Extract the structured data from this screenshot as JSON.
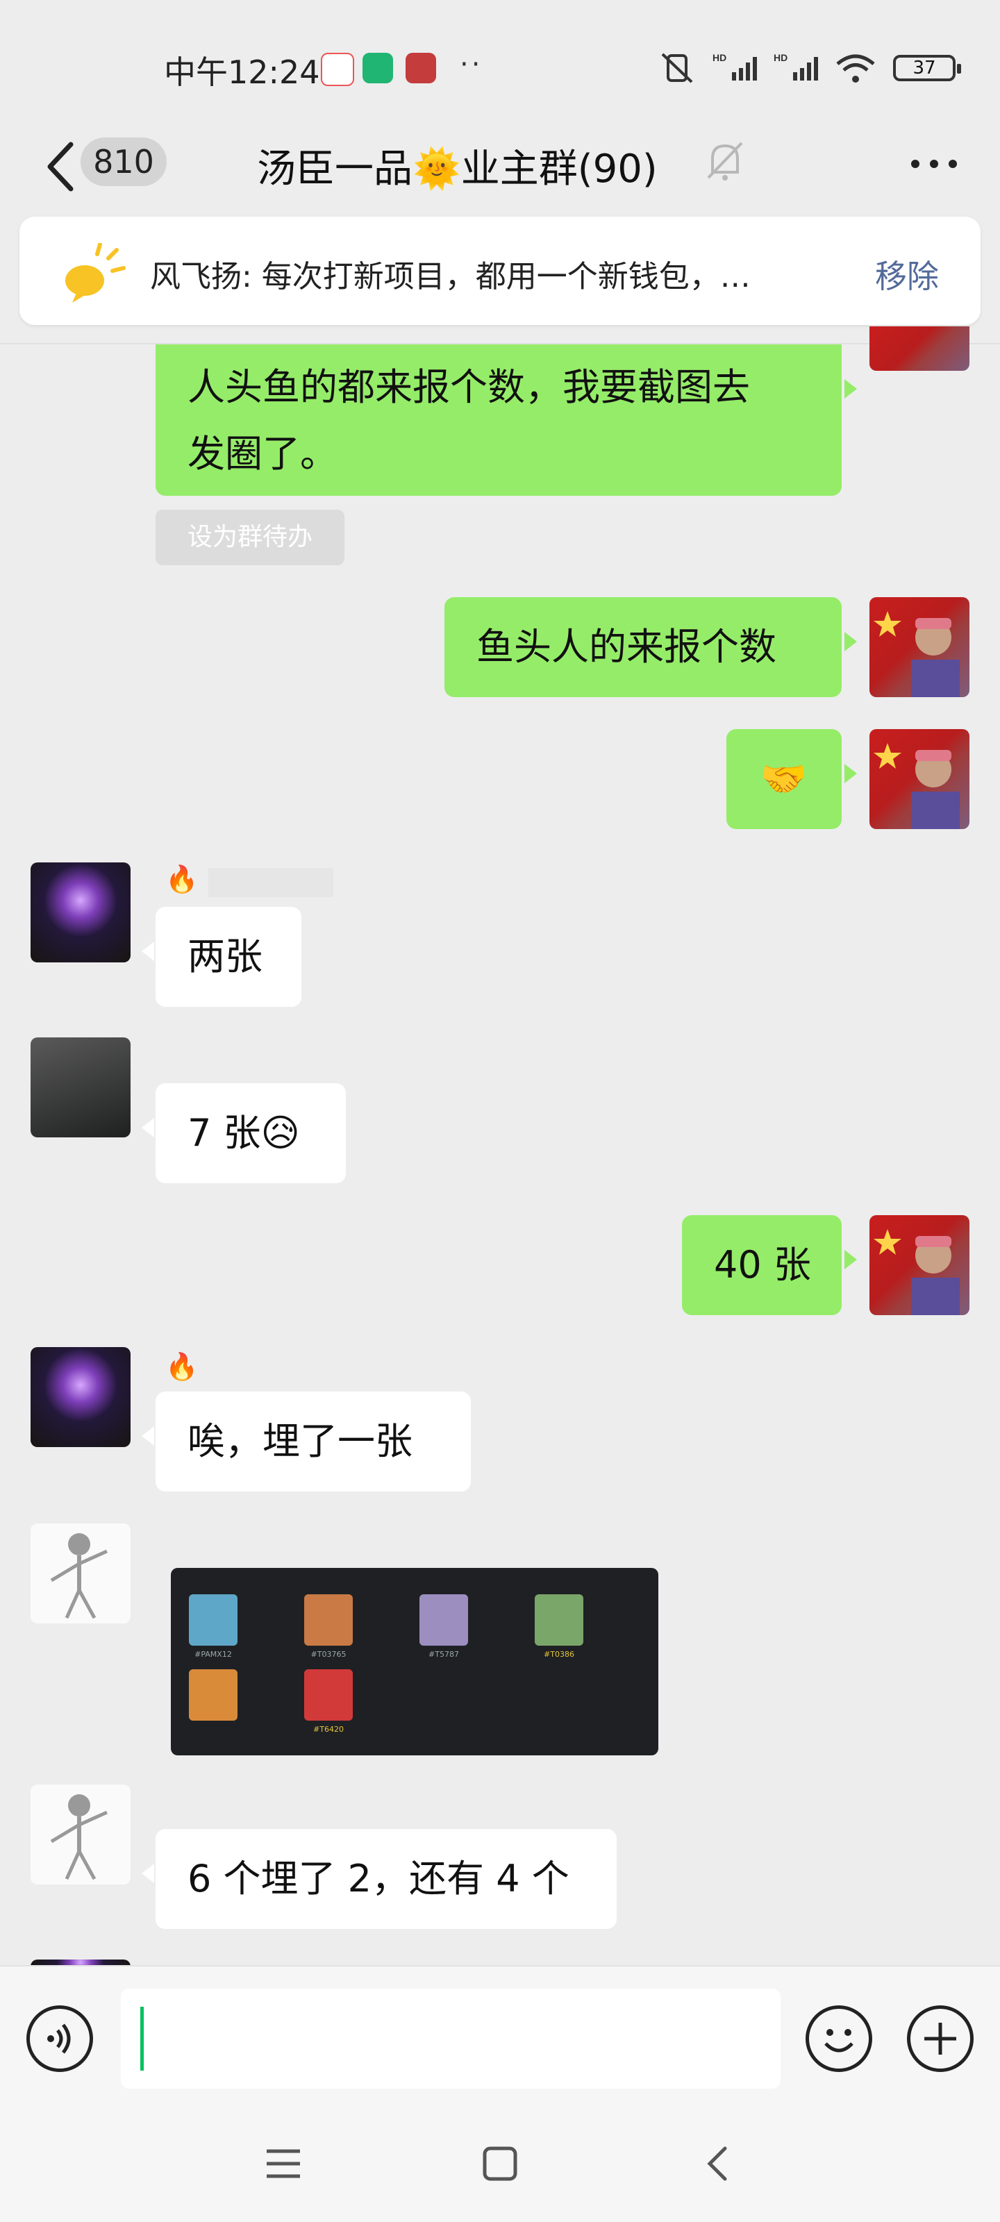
{
  "status_bar": {
    "time": "中午12:24",
    "battery": "37",
    "signal_label": "HD"
  },
  "header": {
    "unread_count": "810",
    "title": "汤臣一品🌞业主群(90)"
  },
  "pinned": {
    "text": "风飞扬: 每次打新项目，都用一个新钱包，…",
    "remove_label": "移除"
  },
  "messages": [
    {
      "side": "right",
      "text_line1": "人头鱼的都来报个数，我要截图去",
      "text_line2": "发圈了。",
      "todo_label": "设为群待办"
    },
    {
      "side": "right",
      "text": "鱼头人的来报个数"
    },
    {
      "side": "right",
      "text": "🤝"
    },
    {
      "side": "left",
      "nick": "🔥",
      "text": "两张"
    },
    {
      "side": "left",
      "text": "7 张😥"
    },
    {
      "side": "right",
      "text": "40 张"
    },
    {
      "side": "left",
      "nick": "🔥",
      "text": "唉，埋了一张"
    },
    {
      "side": "left",
      "type": "image"
    },
    {
      "side": "left",
      "text": "6 个埋了 2，还有 4 个"
    }
  ],
  "image_tiles": [
    {
      "color": "#5fa7c8",
      "label": "#PAMX12"
    },
    {
      "color": "#c97a45",
      "label": "#T03765"
    },
    {
      "color": "#9c8fc0",
      "label": "#T5787"
    },
    {
      "color": "#7aa66a",
      "label": "#T0386",
      "highlight": true
    },
    {
      "color": "#d98b3a",
      "label": ""
    },
    {
      "color": "#d23a3a",
      "label": "#T6420",
      "highlight": true
    }
  ],
  "input": {
    "value": "",
    "placeholder": ""
  },
  "colors": {
    "green_bubble": "#95ec69",
    "background": "#ededed",
    "link": "#536b9a"
  }
}
